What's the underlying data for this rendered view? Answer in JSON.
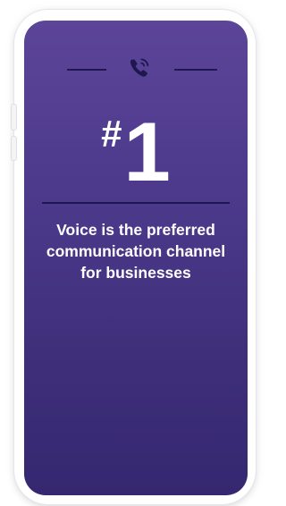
{
  "stat": {
    "hash": "#",
    "number": "1",
    "text": "Voice is the preferred communication channel for businesses"
  },
  "icons": {
    "top": "phone-calling-icon"
  },
  "colors": {
    "screen_top": "#5c4599",
    "screen_bottom": "#352770",
    "divider": "#1f1750",
    "text": "#ffffff",
    "shell": "#ffffff"
  }
}
